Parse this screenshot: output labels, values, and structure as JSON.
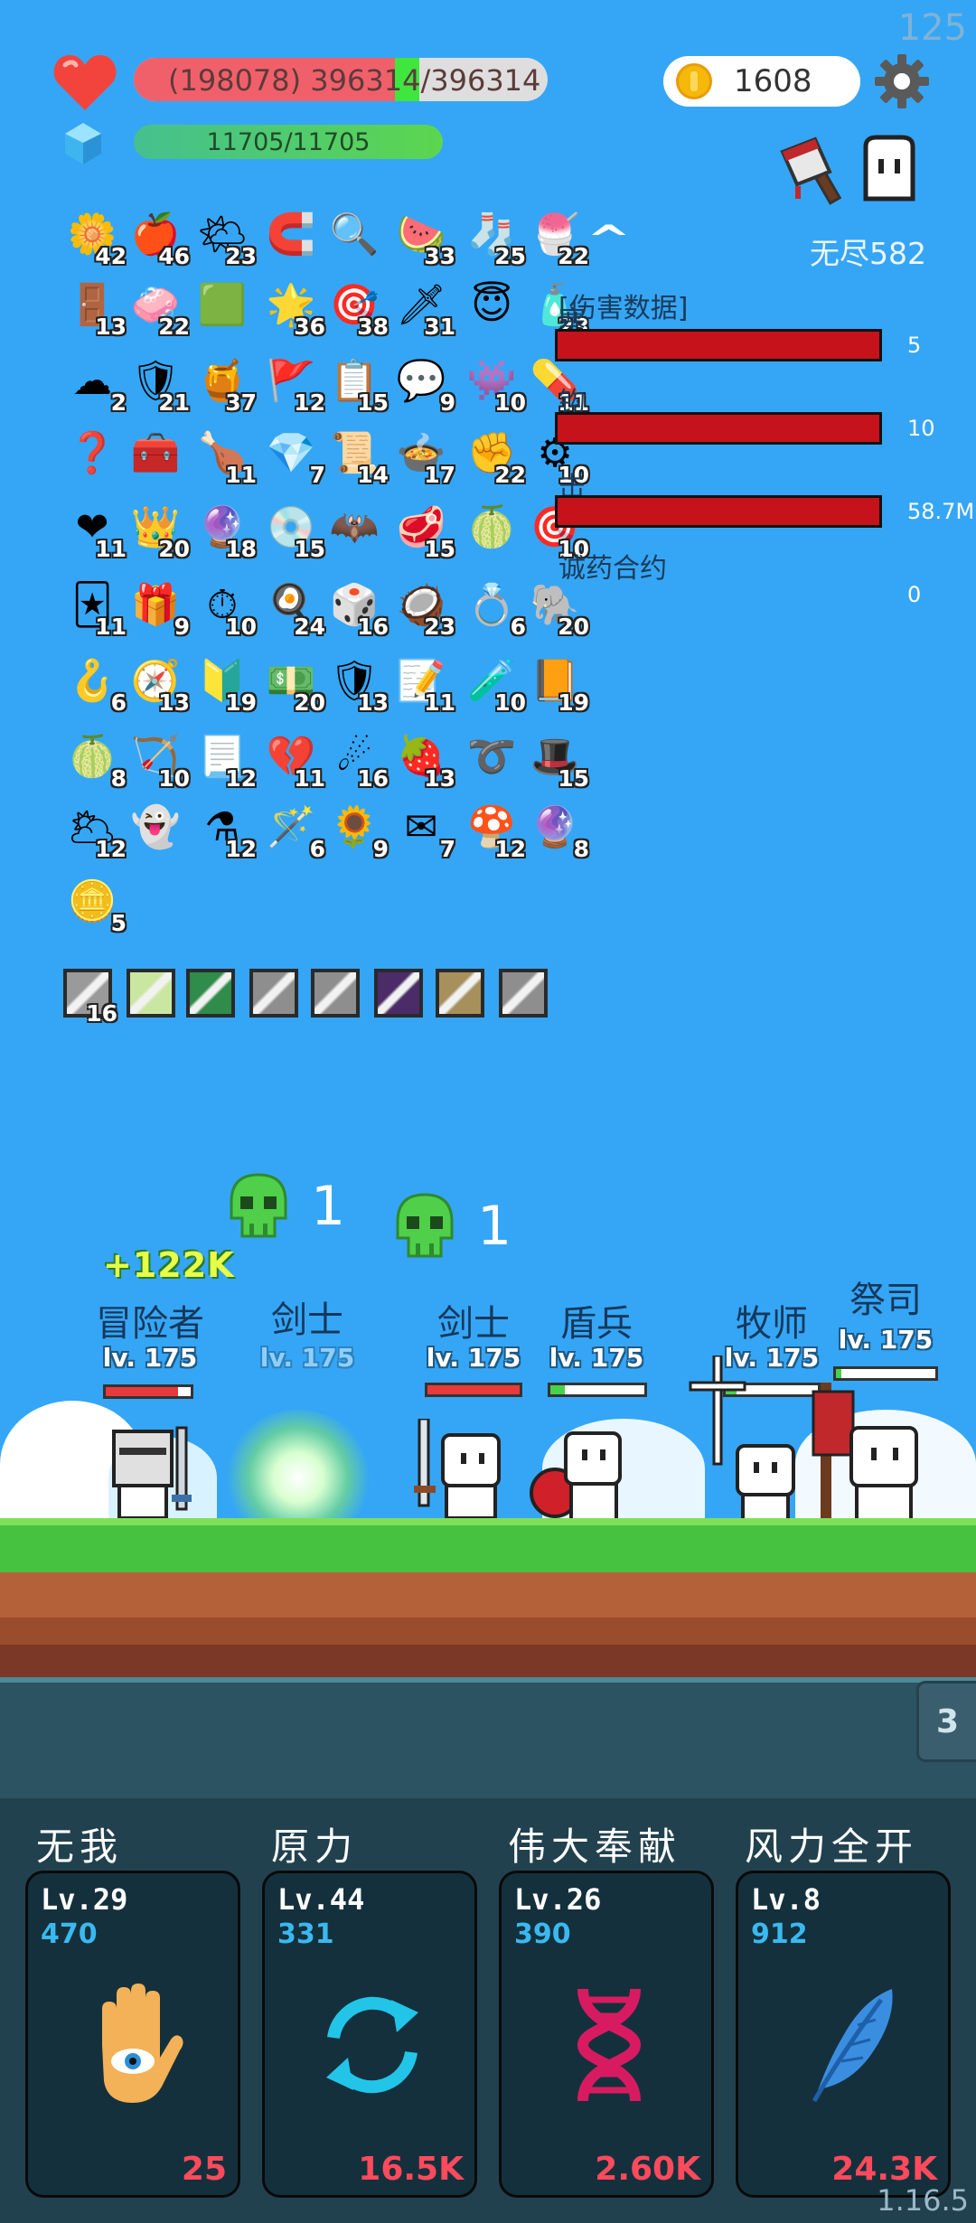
{
  "fps": "125",
  "hp": {
    "current_display": "(198078) 396314/396314",
    "text_part1": "(198078) 39631",
    "text_part2": "4/396314",
    "fill_fraction": 0.63
  },
  "mp": {
    "text": "11705/11705",
    "fill_fraction": 1.0
  },
  "coins": "1608",
  "mode_label": "无尽582",
  "items": [
    {
      "icon": "egg-flower-icon",
      "glyph": "🌼",
      "count": "42"
    },
    {
      "icon": "apple-icon",
      "glyph": "🍎",
      "count": "46"
    },
    {
      "icon": "sun-cloud-icon",
      "glyph": "🌤",
      "count": "23"
    },
    {
      "icon": "magnet-icon",
      "glyph": "🧲",
      "count": ""
    },
    {
      "icon": "magnifier-icon",
      "glyph": "🔍",
      "count": ""
    },
    {
      "icon": "watermelon-icon",
      "glyph": "🍉",
      "count": "33"
    },
    {
      "icon": "sock-icon",
      "glyph": "🧦",
      "count": "25"
    },
    {
      "icon": "ice-cream-icon",
      "glyph": "🍧",
      "count": "22"
    },
    {
      "icon": "door-icon",
      "glyph": "🚪",
      "count": "13"
    },
    {
      "icon": "eraser-icon",
      "glyph": "🧼",
      "count": "22"
    },
    {
      "icon": "card-icon",
      "glyph": "🟩",
      "count": ""
    },
    {
      "icon": "star-frame-icon",
      "glyph": "🌟",
      "count": "36"
    },
    {
      "icon": "target-board-icon",
      "glyph": "🎯",
      "count": "38"
    },
    {
      "icon": "sword-icon",
      "glyph": "🗡",
      "count": "31"
    },
    {
      "icon": "halo-icon",
      "glyph": "😇",
      "count": ""
    },
    {
      "icon": "spray-bottle-icon",
      "glyph": "🧴",
      "count": "23"
    },
    {
      "icon": "cloud-icon",
      "glyph": "☁",
      "count": "2"
    },
    {
      "icon": "shield-icon",
      "glyph": "🛡",
      "count": "21"
    },
    {
      "icon": "jam-jar-icon",
      "glyph": "🍯",
      "count": "37"
    },
    {
      "icon": "red-flag-icon",
      "glyph": "🚩",
      "count": "12"
    },
    {
      "icon": "clipboard-icon",
      "glyph": "📋",
      "count": "15"
    },
    {
      "icon": "speech-bubble-icon",
      "glyph": "💬",
      "count": "9"
    },
    {
      "icon": "green-monster-icon",
      "glyph": "👾",
      "count": "10"
    },
    {
      "icon": "pill-icon",
      "glyph": "💊",
      "count": "11"
    },
    {
      "icon": "hook-icon",
      "glyph": "❓",
      "count": ""
    },
    {
      "icon": "treasure-chest-icon",
      "glyph": "🧰",
      "count": ""
    },
    {
      "icon": "drumstick-icon",
      "glyph": "🍗",
      "count": "11"
    },
    {
      "icon": "blue-gem-icon",
      "glyph": "💎",
      "count": "7"
    },
    {
      "icon": "scroll-icon",
      "glyph": "📜",
      "count": "14"
    },
    {
      "icon": "black-pot-icon",
      "glyph": "🍲",
      "count": "17"
    },
    {
      "icon": "fist-icon",
      "glyph": "✊",
      "count": "22"
    },
    {
      "icon": "spiked-ball-icon",
      "glyph": "⚙",
      "count": "10"
    },
    {
      "icon": "heart-icon",
      "glyph": "❤",
      "count": "11"
    },
    {
      "icon": "crown-icon",
      "glyph": "👑",
      "count": "20"
    },
    {
      "icon": "blue-orb-icon",
      "glyph": "🔮",
      "count": "18"
    },
    {
      "icon": "disc-icon",
      "glyph": "💿",
      "count": "15"
    },
    {
      "icon": "bat-icon",
      "glyph": "🦇",
      "count": ""
    },
    {
      "icon": "meat-icon",
      "glyph": "🥩",
      "count": "15"
    },
    {
      "icon": "grenade-icon",
      "glyph": "🍈",
      "count": ""
    },
    {
      "icon": "crosshair-icon",
      "glyph": "🎯",
      "count": "10"
    },
    {
      "icon": "playing-cards-icon",
      "glyph": "🃏",
      "count": "11"
    },
    {
      "icon": "gift-icon",
      "glyph": "🎁",
      "count": "9"
    },
    {
      "icon": "stopwatch-icon",
      "glyph": "⏱",
      "count": "10"
    },
    {
      "icon": "fried-egg-icon",
      "glyph": "🍳",
      "count": "24"
    },
    {
      "icon": "dice-icon",
      "glyph": "🎲",
      "count": "16"
    },
    {
      "icon": "coconut-icon",
      "glyph": "🥥",
      "count": "23"
    },
    {
      "icon": "ring-icon",
      "glyph": "💍",
      "count": "6"
    },
    {
      "icon": "elephant-icon",
      "glyph": "🐘",
      "count": "20"
    },
    {
      "icon": "fishing-hook-icon",
      "glyph": "🪝",
      "count": "6"
    },
    {
      "icon": "compass-icon",
      "glyph": "🧭",
      "count": "13"
    },
    {
      "icon": "purple-shield-icon",
      "glyph": "🔰",
      "count": "19"
    },
    {
      "icon": "money-heart-icon",
      "glyph": "💵",
      "count": "20"
    },
    {
      "icon": "red-shield-icon",
      "glyph": "🛡",
      "count": "13"
    },
    {
      "icon": "note-pen-icon",
      "glyph": "📝",
      "count": "11"
    },
    {
      "icon": "potion-bottle-icon",
      "glyph": "🧪",
      "count": "10"
    },
    {
      "icon": "spellbook-icon",
      "glyph": "📙",
      "count": "19"
    },
    {
      "icon": "lime-icon",
      "glyph": "🍈",
      "count": "8"
    },
    {
      "icon": "bow-icon",
      "glyph": "🏹",
      "count": "10"
    },
    {
      "icon": "paper-scroll-icon",
      "glyph": "📃",
      "count": "12"
    },
    {
      "icon": "bandaged-heart-icon",
      "glyph": "💔",
      "count": "11"
    },
    {
      "icon": "meteor-icon",
      "glyph": "☄",
      "count": "16"
    },
    {
      "icon": "strawberry-icon",
      "glyph": "🍓",
      "count": "13"
    },
    {
      "icon": "noose-icon",
      "glyph": "➰",
      "count": ""
    },
    {
      "icon": "magic-hat-icon",
      "glyph": "🎩",
      "count": "15"
    },
    {
      "icon": "grey-cloud-icon",
      "glyph": "🌥",
      "count": "12"
    },
    {
      "icon": "ghost-icon",
      "glyph": "👻",
      "count": ""
    },
    {
      "icon": "flask-icon",
      "glyph": "⚗",
      "count": "12"
    },
    {
      "icon": "magic-wand-icon",
      "glyph": "🪄",
      "count": "6"
    },
    {
      "icon": "sunflower-icon",
      "glyph": "🌻",
      "count": "9"
    },
    {
      "icon": "envelope-icon",
      "glyph": "✉",
      "count": "7"
    },
    {
      "icon": "mushroom-icon",
      "glyph": "🍄",
      "count": "12"
    },
    {
      "icon": "crystal-ball-icon",
      "glyph": "🔮",
      "count": "8"
    },
    {
      "icon": "coin-stack-icon",
      "glyph": "🪙",
      "count": "5"
    }
  ],
  "equipment": [
    {
      "icon": "sword-slot-icon",
      "count": "16",
      "color": "#9a9a9a"
    },
    {
      "icon": "light-slot-icon",
      "count": "",
      "color": "#c9e7a0"
    },
    {
      "icon": "green-slot-icon",
      "count": "",
      "color": "#2f8c4a"
    },
    {
      "icon": "blade-slot-icon",
      "count": "",
      "color": "#8e8e8e"
    },
    {
      "icon": "blade-slot-icon-2",
      "count": "",
      "color": "#8e8e8e"
    },
    {
      "icon": "dark-slot-icon",
      "count": "",
      "color": "#4b2c68"
    },
    {
      "icon": "armor-slot-icon",
      "count": "",
      "color": "#a7905c"
    },
    {
      "icon": "blade-slot-icon-3",
      "count": "",
      "color": "#8e8e8e"
    }
  ],
  "damage_panel": {
    "title": "[伤害数据]",
    "rows": [
      {
        "label": "塞",
        "value": "5"
      },
      {
        "label": "钩",
        "value": "10"
      },
      {
        "label": "击",
        "value": "58.7M"
      },
      {
        "label": "诚药合约",
        "value": "0"
      }
    ]
  },
  "kills": [
    {
      "value": "1"
    },
    {
      "value": "1"
    }
  ],
  "heal_text": "+122K",
  "heroes": [
    {
      "name": "冒险者",
      "level": "lv. 175",
      "hp": 0.85,
      "hp_color": "#e83a3a"
    },
    {
      "name": "剑士",
      "level": "lv. 175",
      "hp": 0.0,
      "hp_color": "#e83a3a"
    },
    {
      "name": "剑士",
      "level": "lv. 175",
      "hp": 1.0,
      "hp_color": "#e83a3a"
    },
    {
      "name": "盾兵",
      "level": "lv. 175",
      "hp": 0.15,
      "hp_color": "#48d14a"
    },
    {
      "name": "牧师",
      "level": "lv. 175",
      "hp": 0.12,
      "hp_color": "#48d14a"
    },
    {
      "name": "祭司",
      "level": "lv. 175",
      "hp": 0.05,
      "hp_color": "#48d14a"
    }
  ],
  "side_tab": "3",
  "skills": [
    {
      "name": "无我",
      "level": "Lv.29",
      "power": "470",
      "cost": "25",
      "icon": "eye-hand-icon"
    },
    {
      "name": "原力",
      "level": "Lv.44",
      "power": "331",
      "cost": "16.5K",
      "icon": "cycle-arrows-icon"
    },
    {
      "name": "伟大奉献",
      "level": "Lv.26",
      "power": "390",
      "cost": "2.60K",
      "icon": "dna-icon"
    },
    {
      "name": "风力全开",
      "level": "Lv.8",
      "power": "912",
      "cost": "24.3K",
      "icon": "feather-icon"
    }
  ],
  "version": "1.16.5"
}
